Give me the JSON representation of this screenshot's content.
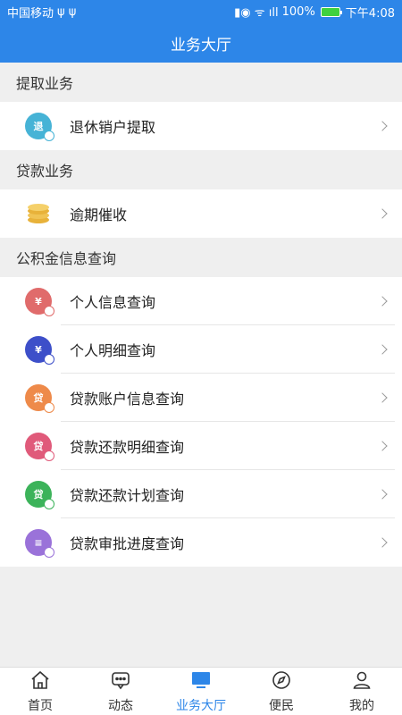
{
  "status": {
    "carrier": "中国移动",
    "indicators": "ψ ψ",
    "battery_pct": "100%",
    "time": "下午4:08"
  },
  "title": "业务大厅",
  "sections": [
    {
      "header": "提取业务",
      "items": [
        {
          "label": "退休销户提取",
          "icon": "retire-icon",
          "glyph": "退",
          "color": "#46b3d6"
        }
      ]
    },
    {
      "header": "贷款业务",
      "items": [
        {
          "label": "逾期催收",
          "icon": "coins-icon",
          "glyph": "",
          "color": "#e8b23a"
        }
      ]
    },
    {
      "header": "公积金信息查询",
      "items": [
        {
          "label": "个人信息查询",
          "icon": "personal-info-icon",
          "glyph": "¥",
          "color": "#e06b6b"
        },
        {
          "label": "个人明细查询",
          "icon": "personal-detail-icon",
          "glyph": "¥",
          "color": "#3d4fc9"
        },
        {
          "label": "贷款账户信息查询",
          "icon": "loan-account-icon",
          "glyph": "贷",
          "color": "#ee8a4a"
        },
        {
          "label": "贷款还款明细查询",
          "icon": "loan-repay-detail-icon",
          "glyph": "贷",
          "color": "#e05a7a"
        },
        {
          "label": "贷款还款计划查询",
          "icon": "loan-repay-plan-icon",
          "glyph": "贷",
          "color": "#3cb35a"
        },
        {
          "label": "贷款审批进度查询",
          "icon": "loan-approval-icon",
          "glyph": "≡",
          "color": "#9a72d9"
        }
      ]
    }
  ],
  "tabs": [
    {
      "label": "首页",
      "icon": "home-icon",
      "active": false
    },
    {
      "label": "动态",
      "icon": "chat-icon",
      "active": false
    },
    {
      "label": "业务大厅",
      "icon": "monitor-icon",
      "active": true
    },
    {
      "label": "便民",
      "icon": "compass-icon",
      "active": false
    },
    {
      "label": "我的",
      "icon": "user-icon",
      "active": false
    }
  ],
  "colors": {
    "primary": "#2d86e8",
    "background": "#efefef"
  }
}
